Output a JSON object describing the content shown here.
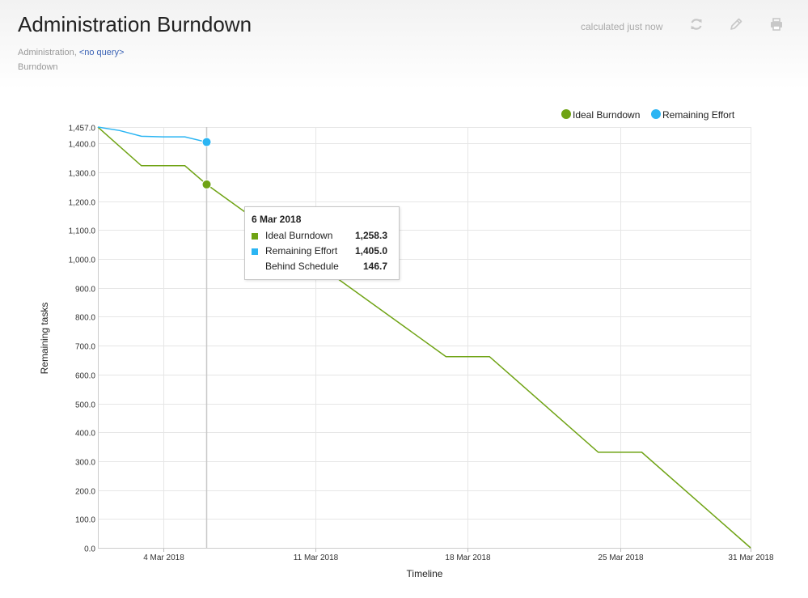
{
  "header": {
    "title": "Administration Burndown",
    "breadcrumb_prefix": "Administration,",
    "breadcrumb_link": "<no query>",
    "subtitle": "Burndown",
    "status": "calculated just now",
    "icons": [
      "refresh-icon",
      "pencil-icon",
      "print-icon"
    ]
  },
  "legend": {
    "ideal": "Ideal Burndown",
    "remaining": "Remaining Effort",
    "placement": "top-right"
  },
  "tooltip": {
    "date": "6 Mar 2018",
    "rows": [
      {
        "label": "Ideal Burndown",
        "value": "1,258.3",
        "color": "#6fa314"
      },
      {
        "label": "Remaining Effort",
        "value": "1,405.0",
        "color": "#2bb5f3"
      },
      {
        "label": "Behind Schedule",
        "value": "146.7",
        "color": ""
      }
    ]
  },
  "chart_data": {
    "type": "line",
    "xlabel": "Timeline",
    "ylabel": "Remaining tasks",
    "x_start": "2018-03-01",
    "x_end": "2018-03-31",
    "xlim": [
      "2018-03-01",
      "2018-03-31"
    ],
    "ylim": [
      0,
      1457
    ],
    "y_ticks": [
      "0.0",
      "100.0",
      "200.0",
      "300.0",
      "400.0",
      "500.0",
      "600.0",
      "700.0",
      "800.0",
      "900.0",
      "1,000.0",
      "1,100.0",
      "1,200.0",
      "1,300.0",
      "1,400.0",
      "1,457.0"
    ],
    "y_tick_values": [
      0,
      100,
      200,
      300,
      400,
      500,
      600,
      700,
      800,
      900,
      1000,
      1100,
      1200,
      1300,
      1400,
      1457
    ],
    "x_ticks": [
      {
        "label": "4 Mar 2018",
        "date": "2018-03-04"
      },
      {
        "label": "11 Mar 2018",
        "date": "2018-03-11"
      },
      {
        "label": "18 Mar 2018",
        "date": "2018-03-18"
      },
      {
        "label": "25 Mar 2018",
        "date": "2018-03-25"
      },
      {
        "label": "31 Mar 2018",
        "date": "2018-03-31"
      }
    ],
    "grid": true,
    "series": [
      {
        "name": "Ideal Burndown",
        "color": "#6fa314",
        "points": [
          {
            "x": "2018-03-01",
            "y": 1457
          },
          {
            "x": "2018-03-03",
            "y": 1323
          },
          {
            "x": "2018-03-05",
            "y": 1323
          },
          {
            "x": "2018-03-06",
            "y": 1258.3
          },
          {
            "x": "2018-03-17",
            "y": 662
          },
          {
            "x": "2018-03-19",
            "y": 662
          },
          {
            "x": "2018-03-24",
            "y": 331
          },
          {
            "x": "2018-03-26",
            "y": 331
          },
          {
            "x": "2018-03-31",
            "y": 0
          }
        ]
      },
      {
        "name": "Remaining Effort",
        "color": "#2bb5f3",
        "points": [
          {
            "x": "2018-03-01",
            "y": 1457
          },
          {
            "x": "2018-03-02",
            "y": 1445
          },
          {
            "x": "2018-03-03",
            "y": 1425
          },
          {
            "x": "2018-03-04",
            "y": 1423
          },
          {
            "x": "2018-03-05",
            "y": 1423
          },
          {
            "x": "2018-03-06",
            "y": 1405
          }
        ]
      }
    ],
    "highlight_date": "2018-03-06"
  }
}
